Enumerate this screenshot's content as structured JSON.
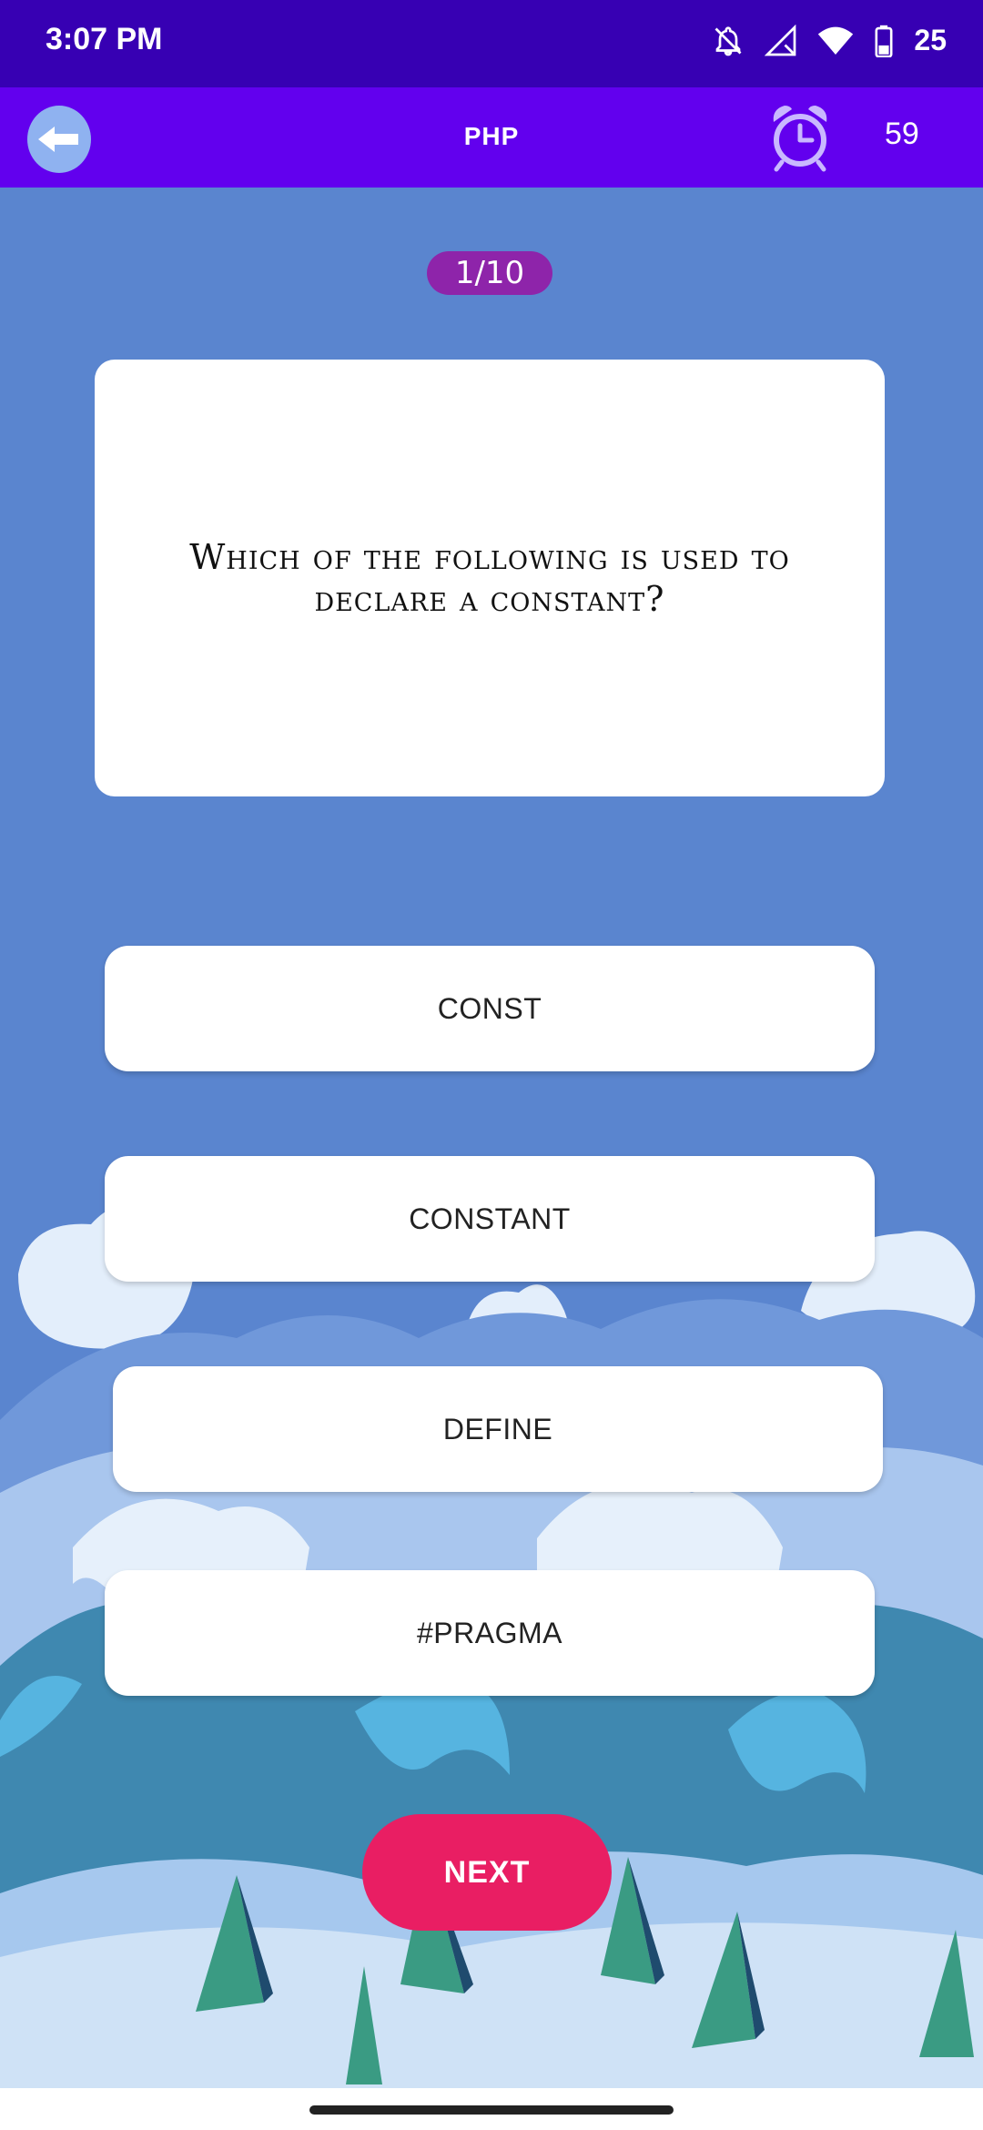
{
  "status_bar": {
    "time": "3:07 PM",
    "battery": "25"
  },
  "app_bar": {
    "title": "PHP",
    "timer": "59"
  },
  "quiz": {
    "progress": "1/10",
    "question": "Which of the following is used to declare a constant?",
    "options": [
      "CONST",
      "CONSTANT",
      "DEFINE",
      "#PRAGMA"
    ],
    "next_label": "NEXT"
  },
  "colors": {
    "status_bar": "#3700b3",
    "app_bar": "#6200ee",
    "background": "#5a85cf",
    "badge": "#8e24aa",
    "next_button": "#e91e63"
  }
}
